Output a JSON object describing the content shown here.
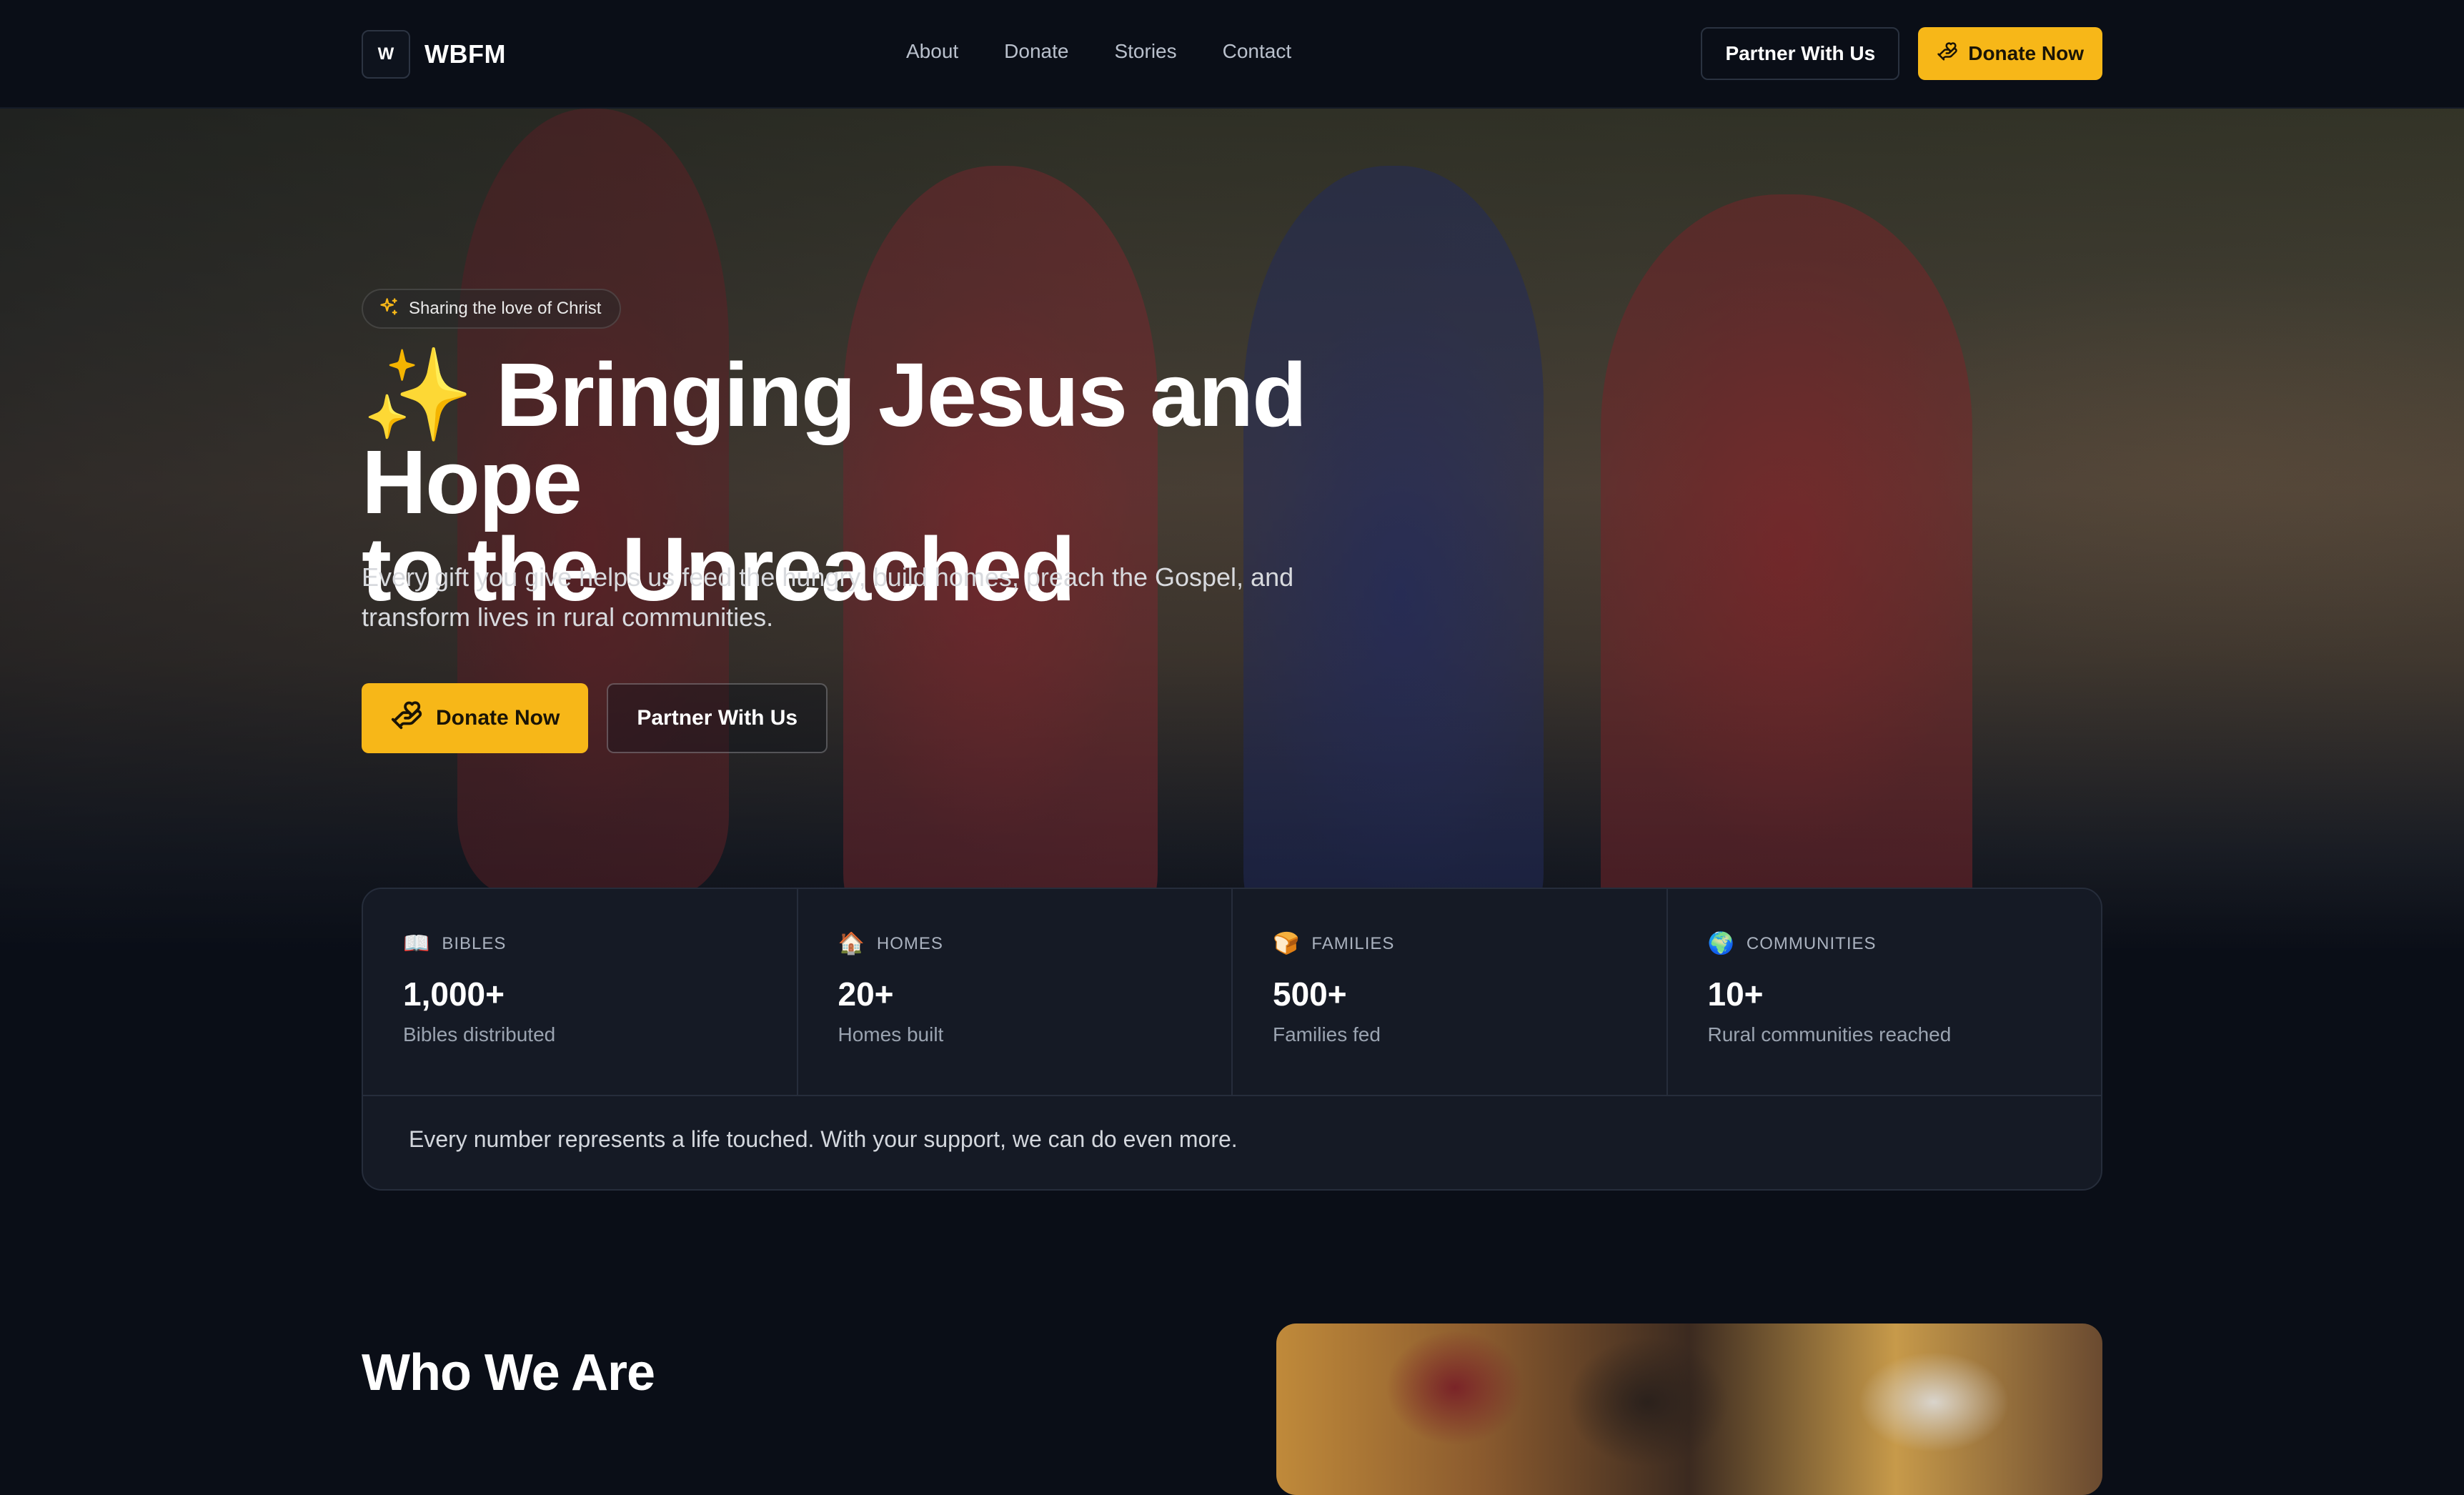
{
  "nav": {
    "logo_mark": "W",
    "logo_text": "WBFM",
    "links": [
      "About",
      "Donate",
      "Stories",
      "Contact"
    ],
    "partner_label": "Partner With Us",
    "donate_label": "Donate Now"
  },
  "hero": {
    "badge_text": "Sharing the love of Christ",
    "title_sparkle": "✨",
    "title_line1": "Bringing Jesus and Hope",
    "title_line2": "to the Unreached",
    "subtitle": "Every gift you give helps us feed the hungry, build homes, preach the Gospel, and transform lives in rural communities.",
    "donate_label": "Donate Now",
    "partner_label": "Partner With Us"
  },
  "stats": {
    "items": [
      {
        "emoji": "📖",
        "category": "BIBLES",
        "value": "1,000+",
        "label": "Bibles distributed"
      },
      {
        "emoji": "🏠",
        "category": "HOMES",
        "value": "20+",
        "label": "Homes built"
      },
      {
        "emoji": "🍞",
        "category": "FAMILIES",
        "value": "500+",
        "label": "Families fed"
      },
      {
        "emoji": "🌍",
        "category": "COMMUNITIES",
        "value": "10+",
        "label": "Rural communities reached"
      }
    ],
    "footer": "Every number represents a life touched. With your support, we can do even more."
  },
  "who": {
    "title": "Who We Are"
  },
  "colors": {
    "background": "#0a0e17",
    "accent": "#f7b718",
    "card": "#151a25"
  }
}
